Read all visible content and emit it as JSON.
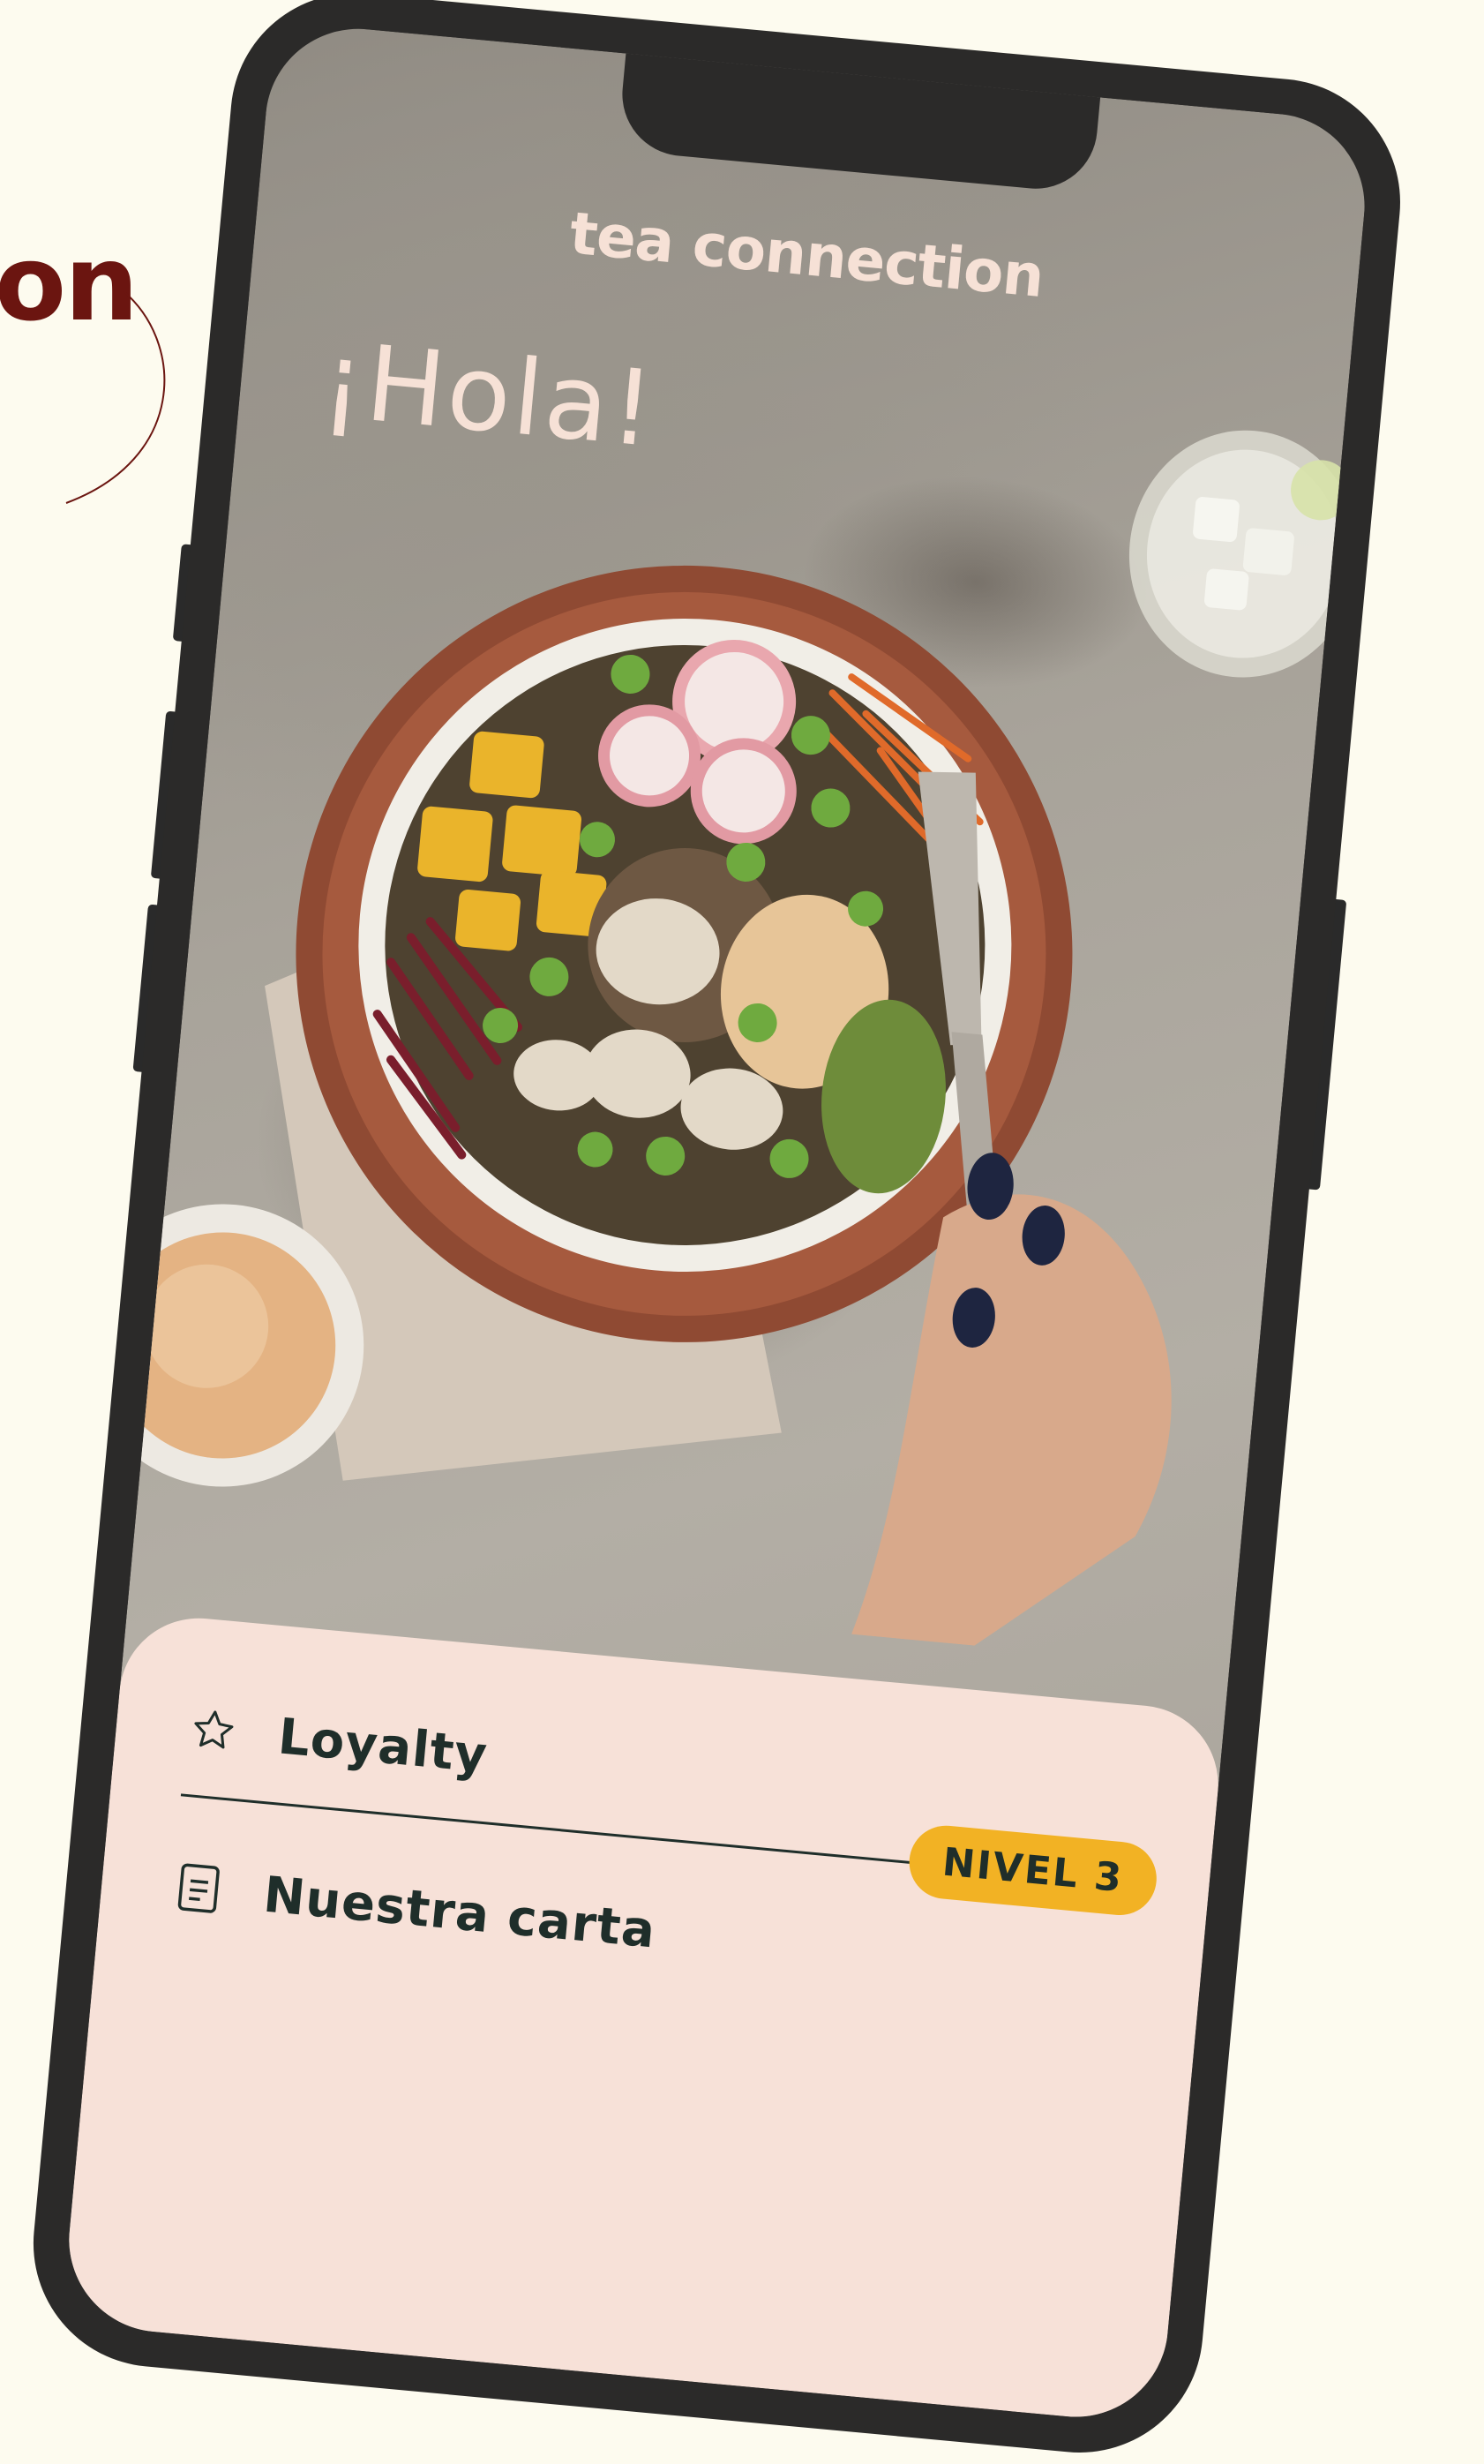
{
  "background": {
    "caption_partial": "on",
    "colors": {
      "page": "#FDFBEF",
      "caption": "#6B1510",
      "phone_frame": "#2B2A29"
    }
  },
  "app": {
    "logo_text": "tea connection",
    "greeting": "¡Hola!",
    "hero_image": "poke bowl with fork held by a hand"
  },
  "menu": {
    "items": [
      {
        "label": "Loyalty",
        "icon": "star-icon"
      },
      {
        "label": "Nuestra carta",
        "icon": "menu-card-icon"
      }
    ],
    "badge": "NIVEL 3"
  },
  "colors": {
    "text_light": "#F6E1D6",
    "sheet": "#F7E1D8",
    "text_dark": "#1F2E2A",
    "badge": "#F2B224"
  }
}
